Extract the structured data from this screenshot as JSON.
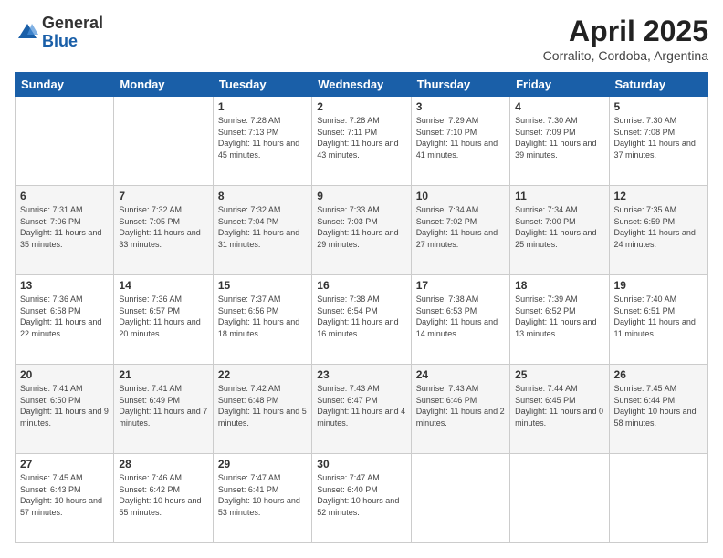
{
  "header": {
    "logo_general": "General",
    "logo_blue": "Blue",
    "month_title": "April 2025",
    "subtitle": "Corralito, Cordoba, Argentina"
  },
  "days_of_week": [
    "Sunday",
    "Monday",
    "Tuesday",
    "Wednesday",
    "Thursday",
    "Friday",
    "Saturday"
  ],
  "weeks": [
    [
      {
        "day": "",
        "sunrise": "",
        "sunset": "",
        "daylight": ""
      },
      {
        "day": "",
        "sunrise": "",
        "sunset": "",
        "daylight": ""
      },
      {
        "day": "1",
        "sunrise": "Sunrise: 7:28 AM",
        "sunset": "Sunset: 7:13 PM",
        "daylight": "Daylight: 11 hours and 45 minutes."
      },
      {
        "day": "2",
        "sunrise": "Sunrise: 7:28 AM",
        "sunset": "Sunset: 7:11 PM",
        "daylight": "Daylight: 11 hours and 43 minutes."
      },
      {
        "day": "3",
        "sunrise": "Sunrise: 7:29 AM",
        "sunset": "Sunset: 7:10 PM",
        "daylight": "Daylight: 11 hours and 41 minutes."
      },
      {
        "day": "4",
        "sunrise": "Sunrise: 7:30 AM",
        "sunset": "Sunset: 7:09 PM",
        "daylight": "Daylight: 11 hours and 39 minutes."
      },
      {
        "day": "5",
        "sunrise": "Sunrise: 7:30 AM",
        "sunset": "Sunset: 7:08 PM",
        "daylight": "Daylight: 11 hours and 37 minutes."
      }
    ],
    [
      {
        "day": "6",
        "sunrise": "Sunrise: 7:31 AM",
        "sunset": "Sunset: 7:06 PM",
        "daylight": "Daylight: 11 hours and 35 minutes."
      },
      {
        "day": "7",
        "sunrise": "Sunrise: 7:32 AM",
        "sunset": "Sunset: 7:05 PM",
        "daylight": "Daylight: 11 hours and 33 minutes."
      },
      {
        "day": "8",
        "sunrise": "Sunrise: 7:32 AM",
        "sunset": "Sunset: 7:04 PM",
        "daylight": "Daylight: 11 hours and 31 minutes."
      },
      {
        "day": "9",
        "sunrise": "Sunrise: 7:33 AM",
        "sunset": "Sunset: 7:03 PM",
        "daylight": "Daylight: 11 hours and 29 minutes."
      },
      {
        "day": "10",
        "sunrise": "Sunrise: 7:34 AM",
        "sunset": "Sunset: 7:02 PM",
        "daylight": "Daylight: 11 hours and 27 minutes."
      },
      {
        "day": "11",
        "sunrise": "Sunrise: 7:34 AM",
        "sunset": "Sunset: 7:00 PM",
        "daylight": "Daylight: 11 hours and 25 minutes."
      },
      {
        "day": "12",
        "sunrise": "Sunrise: 7:35 AM",
        "sunset": "Sunset: 6:59 PM",
        "daylight": "Daylight: 11 hours and 24 minutes."
      }
    ],
    [
      {
        "day": "13",
        "sunrise": "Sunrise: 7:36 AM",
        "sunset": "Sunset: 6:58 PM",
        "daylight": "Daylight: 11 hours and 22 minutes."
      },
      {
        "day": "14",
        "sunrise": "Sunrise: 7:36 AM",
        "sunset": "Sunset: 6:57 PM",
        "daylight": "Daylight: 11 hours and 20 minutes."
      },
      {
        "day": "15",
        "sunrise": "Sunrise: 7:37 AM",
        "sunset": "Sunset: 6:56 PM",
        "daylight": "Daylight: 11 hours and 18 minutes."
      },
      {
        "day": "16",
        "sunrise": "Sunrise: 7:38 AM",
        "sunset": "Sunset: 6:54 PM",
        "daylight": "Daylight: 11 hours and 16 minutes."
      },
      {
        "day": "17",
        "sunrise": "Sunrise: 7:38 AM",
        "sunset": "Sunset: 6:53 PM",
        "daylight": "Daylight: 11 hours and 14 minutes."
      },
      {
        "day": "18",
        "sunrise": "Sunrise: 7:39 AM",
        "sunset": "Sunset: 6:52 PM",
        "daylight": "Daylight: 11 hours and 13 minutes."
      },
      {
        "day": "19",
        "sunrise": "Sunrise: 7:40 AM",
        "sunset": "Sunset: 6:51 PM",
        "daylight": "Daylight: 11 hours and 11 minutes."
      }
    ],
    [
      {
        "day": "20",
        "sunrise": "Sunrise: 7:41 AM",
        "sunset": "Sunset: 6:50 PM",
        "daylight": "Daylight: 11 hours and 9 minutes."
      },
      {
        "day": "21",
        "sunrise": "Sunrise: 7:41 AM",
        "sunset": "Sunset: 6:49 PM",
        "daylight": "Daylight: 11 hours and 7 minutes."
      },
      {
        "day": "22",
        "sunrise": "Sunrise: 7:42 AM",
        "sunset": "Sunset: 6:48 PM",
        "daylight": "Daylight: 11 hours and 5 minutes."
      },
      {
        "day": "23",
        "sunrise": "Sunrise: 7:43 AM",
        "sunset": "Sunset: 6:47 PM",
        "daylight": "Daylight: 11 hours and 4 minutes."
      },
      {
        "day": "24",
        "sunrise": "Sunrise: 7:43 AM",
        "sunset": "Sunset: 6:46 PM",
        "daylight": "Daylight: 11 hours and 2 minutes."
      },
      {
        "day": "25",
        "sunrise": "Sunrise: 7:44 AM",
        "sunset": "Sunset: 6:45 PM",
        "daylight": "Daylight: 11 hours and 0 minutes."
      },
      {
        "day": "26",
        "sunrise": "Sunrise: 7:45 AM",
        "sunset": "Sunset: 6:44 PM",
        "daylight": "Daylight: 10 hours and 58 minutes."
      }
    ],
    [
      {
        "day": "27",
        "sunrise": "Sunrise: 7:45 AM",
        "sunset": "Sunset: 6:43 PM",
        "daylight": "Daylight: 10 hours and 57 minutes."
      },
      {
        "day": "28",
        "sunrise": "Sunrise: 7:46 AM",
        "sunset": "Sunset: 6:42 PM",
        "daylight": "Daylight: 10 hours and 55 minutes."
      },
      {
        "day": "29",
        "sunrise": "Sunrise: 7:47 AM",
        "sunset": "Sunset: 6:41 PM",
        "daylight": "Daylight: 10 hours and 53 minutes."
      },
      {
        "day": "30",
        "sunrise": "Sunrise: 7:47 AM",
        "sunset": "Sunset: 6:40 PM",
        "daylight": "Daylight: 10 hours and 52 minutes."
      },
      {
        "day": "",
        "sunrise": "",
        "sunset": "",
        "daylight": ""
      },
      {
        "day": "",
        "sunrise": "",
        "sunset": "",
        "daylight": ""
      },
      {
        "day": "",
        "sunrise": "",
        "sunset": "",
        "daylight": ""
      }
    ]
  ]
}
